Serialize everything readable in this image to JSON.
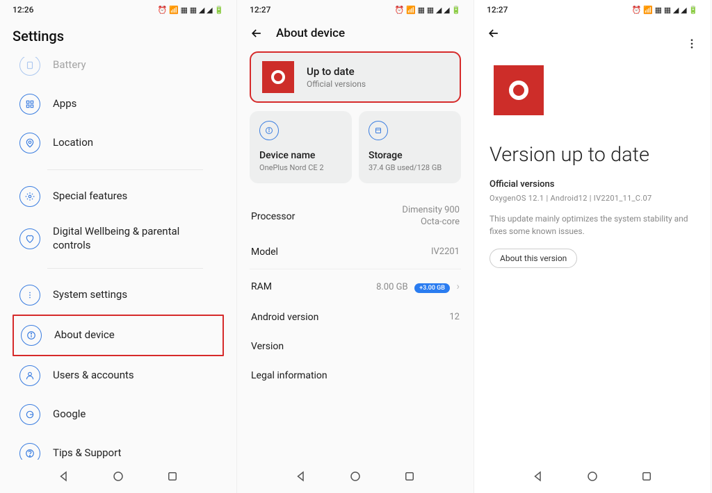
{
  "screen1": {
    "time": "12:26",
    "title": "Settings",
    "items": [
      {
        "label": "Battery"
      },
      {
        "label": "Apps"
      },
      {
        "label": "Location"
      },
      {
        "label": "Special features"
      },
      {
        "label": "Digital Wellbeing & parental controls"
      },
      {
        "label": "System settings"
      },
      {
        "label": "About device"
      },
      {
        "label": "Users & accounts"
      },
      {
        "label": "Google"
      },
      {
        "label": "Tips & Support"
      }
    ]
  },
  "screen2": {
    "time": "12:27",
    "title": "About device",
    "uptodate": {
      "title": "Up to date",
      "subtitle": "Official versions"
    },
    "device_name": {
      "title": "Device name",
      "value": "OnePlus Nord CE 2"
    },
    "storage": {
      "title": "Storage",
      "value": "37.4 GB used/128 GB"
    },
    "specs": {
      "processor": {
        "k": "Processor",
        "v": "Dimensity 900\nOcta-core"
      },
      "model": {
        "k": "Model",
        "v": "IV2201"
      },
      "ram": {
        "k": "RAM",
        "v": "8.00 GB",
        "badge": "+3.00 GB"
      },
      "android": {
        "k": "Android version",
        "v": "12"
      },
      "version": {
        "k": "Version"
      },
      "legal": {
        "k": "Legal information"
      }
    }
  },
  "screen3": {
    "time": "12:27",
    "title": "Version up to date",
    "subtitle": "Official versions",
    "chips": "OxygenOS 12.1   |   Android12   |   IV2201_11_C.07",
    "desc": "This update mainly optimizes the system stability and fixes some known issues.",
    "button": "About this version"
  }
}
